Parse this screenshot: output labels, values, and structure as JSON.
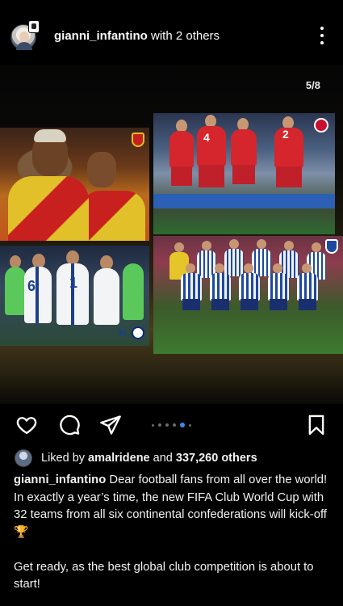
{
  "header": {
    "username": "gianni_infantino",
    "collab_text": " with 2 others",
    "avatar_icon": "profile-avatar",
    "more_icon": "more-vertical-icon"
  },
  "post": {
    "carousel_counter": "5/8",
    "photo_labels": {
      "p2_num_a": "4",
      "p2_num_b": "2",
      "p3_num_a": "6",
      "p3_num_b": "1",
      "p3_tag": "95"
    }
  },
  "actions": {
    "like_icon": "heart-icon",
    "comment_icon": "comment-icon",
    "share_icon": "send-icon",
    "save_icon": "bookmark-icon",
    "carousel_total": 6,
    "carousel_active_index": 4
  },
  "likes": {
    "prefix": "Liked by ",
    "user": "amalridene",
    "middle": " and ",
    "count": "337,260 others"
  },
  "caption": {
    "username": "gianni_infantino",
    "text1": " Dear football fans from all over the world! In exactly a year’s time, the new FIFA Club World Cup with 32 teams from all six continental confederations will kick-off 🏆",
    "text2": "Get ready, as the best global club competition is about to start!"
  },
  "colors": {
    "background": "#000000",
    "text": "#f5f5f5",
    "carousel_active": "#3a8cf5"
  }
}
